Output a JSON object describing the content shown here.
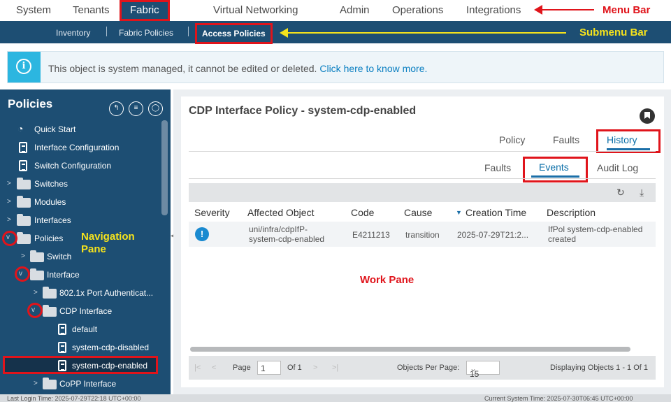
{
  "menu": {
    "items": [
      "System",
      "Tenants",
      "Fabric",
      "Virtual Networking",
      "Admin",
      "Operations",
      "Integrations"
    ],
    "active": "Fabric"
  },
  "submenu": {
    "items": [
      "Inventory",
      "Fabric Policies",
      "Access Policies"
    ],
    "active": "Access Policies"
  },
  "annotations": {
    "menu_bar": "Menu Bar",
    "submenu_bar": "Submenu Bar",
    "navigation_pane": "Navigation Pane",
    "work_pane": "Work Pane"
  },
  "banner": {
    "icon": "i",
    "message": "This object is system managed, it cannot be edited or deleted.",
    "link": "Click here to know more."
  },
  "nav": {
    "title": "Policies",
    "title_icons": [
      "quick-start-icon",
      "list-icon",
      "refresh-icon"
    ],
    "items": [
      {
        "label": "Quick Start",
        "icon": "quick-start-icon"
      },
      {
        "label": "Interface Configuration",
        "icon": "document-icon"
      },
      {
        "label": "Switch Configuration",
        "icon": "document-icon"
      },
      {
        "label": "Switches",
        "icon": "folder-icon"
      },
      {
        "label": "Modules",
        "icon": "folder-icon"
      },
      {
        "label": "Interfaces",
        "icon": "folder-icon"
      },
      {
        "label": "Policies",
        "icon": "folder-icon"
      },
      {
        "label": "Switch",
        "icon": "folder-icon"
      },
      {
        "label": "Interface",
        "icon": "folder-icon"
      },
      {
        "label": "802.1x Port Authenticat...",
        "icon": "folder-icon"
      },
      {
        "label": "CDP Interface",
        "icon": "folder-icon"
      },
      {
        "label": "default",
        "icon": "document-icon"
      },
      {
        "label": "system-cdp-disabled",
        "icon": "document-icon"
      },
      {
        "label": "system-cdp-enabled",
        "icon": "document-icon"
      },
      {
        "label": "CoPP Interface",
        "icon": "folder-icon"
      }
    ],
    "selected": "system-cdp-enabled"
  },
  "work": {
    "title": "CDP Interface Policy - system-cdp-enabled",
    "tabs": [
      "Policy",
      "Faults",
      "History"
    ],
    "active_tab": "History",
    "subtabs": [
      "Faults",
      "Events",
      "Audit Log"
    ],
    "active_subtab": "Events",
    "columns": [
      "Severity",
      "Affected Object",
      "Code",
      "Cause",
      "Creation Time",
      "Description"
    ],
    "rows": [
      {
        "severity": "!",
        "affected_object_1": "uni/infra/cdpIfP-",
        "affected_object_2": "system-cdp-enabled",
        "code": "E4211213",
        "cause": "transition",
        "creation_time": "2025-07-29T21:2...",
        "description_1": "IfPol system-cdp-enabled",
        "description_2": "created"
      }
    ],
    "pager": {
      "page_label": "Page",
      "page_value": "1",
      "of_label": "Of 1",
      "per_page_label": "Objects Per Page:",
      "per_page_value": "15",
      "displaying": "Displaying Objects 1 - 1 Of 1"
    }
  },
  "footer": {
    "last_login": "Last Login Time: 2025-07-29T22:18 UTC+00:00",
    "current_time": "Current System Time: 2025-07-30T06:45 UTC+00:00"
  },
  "colors": {
    "nav_bg": "#1d4e73",
    "annotation_red": "#e0141b",
    "annotation_yellow": "#f6e31c",
    "banner_accent": "#2cb6e0",
    "link": "#0b7fc1"
  }
}
